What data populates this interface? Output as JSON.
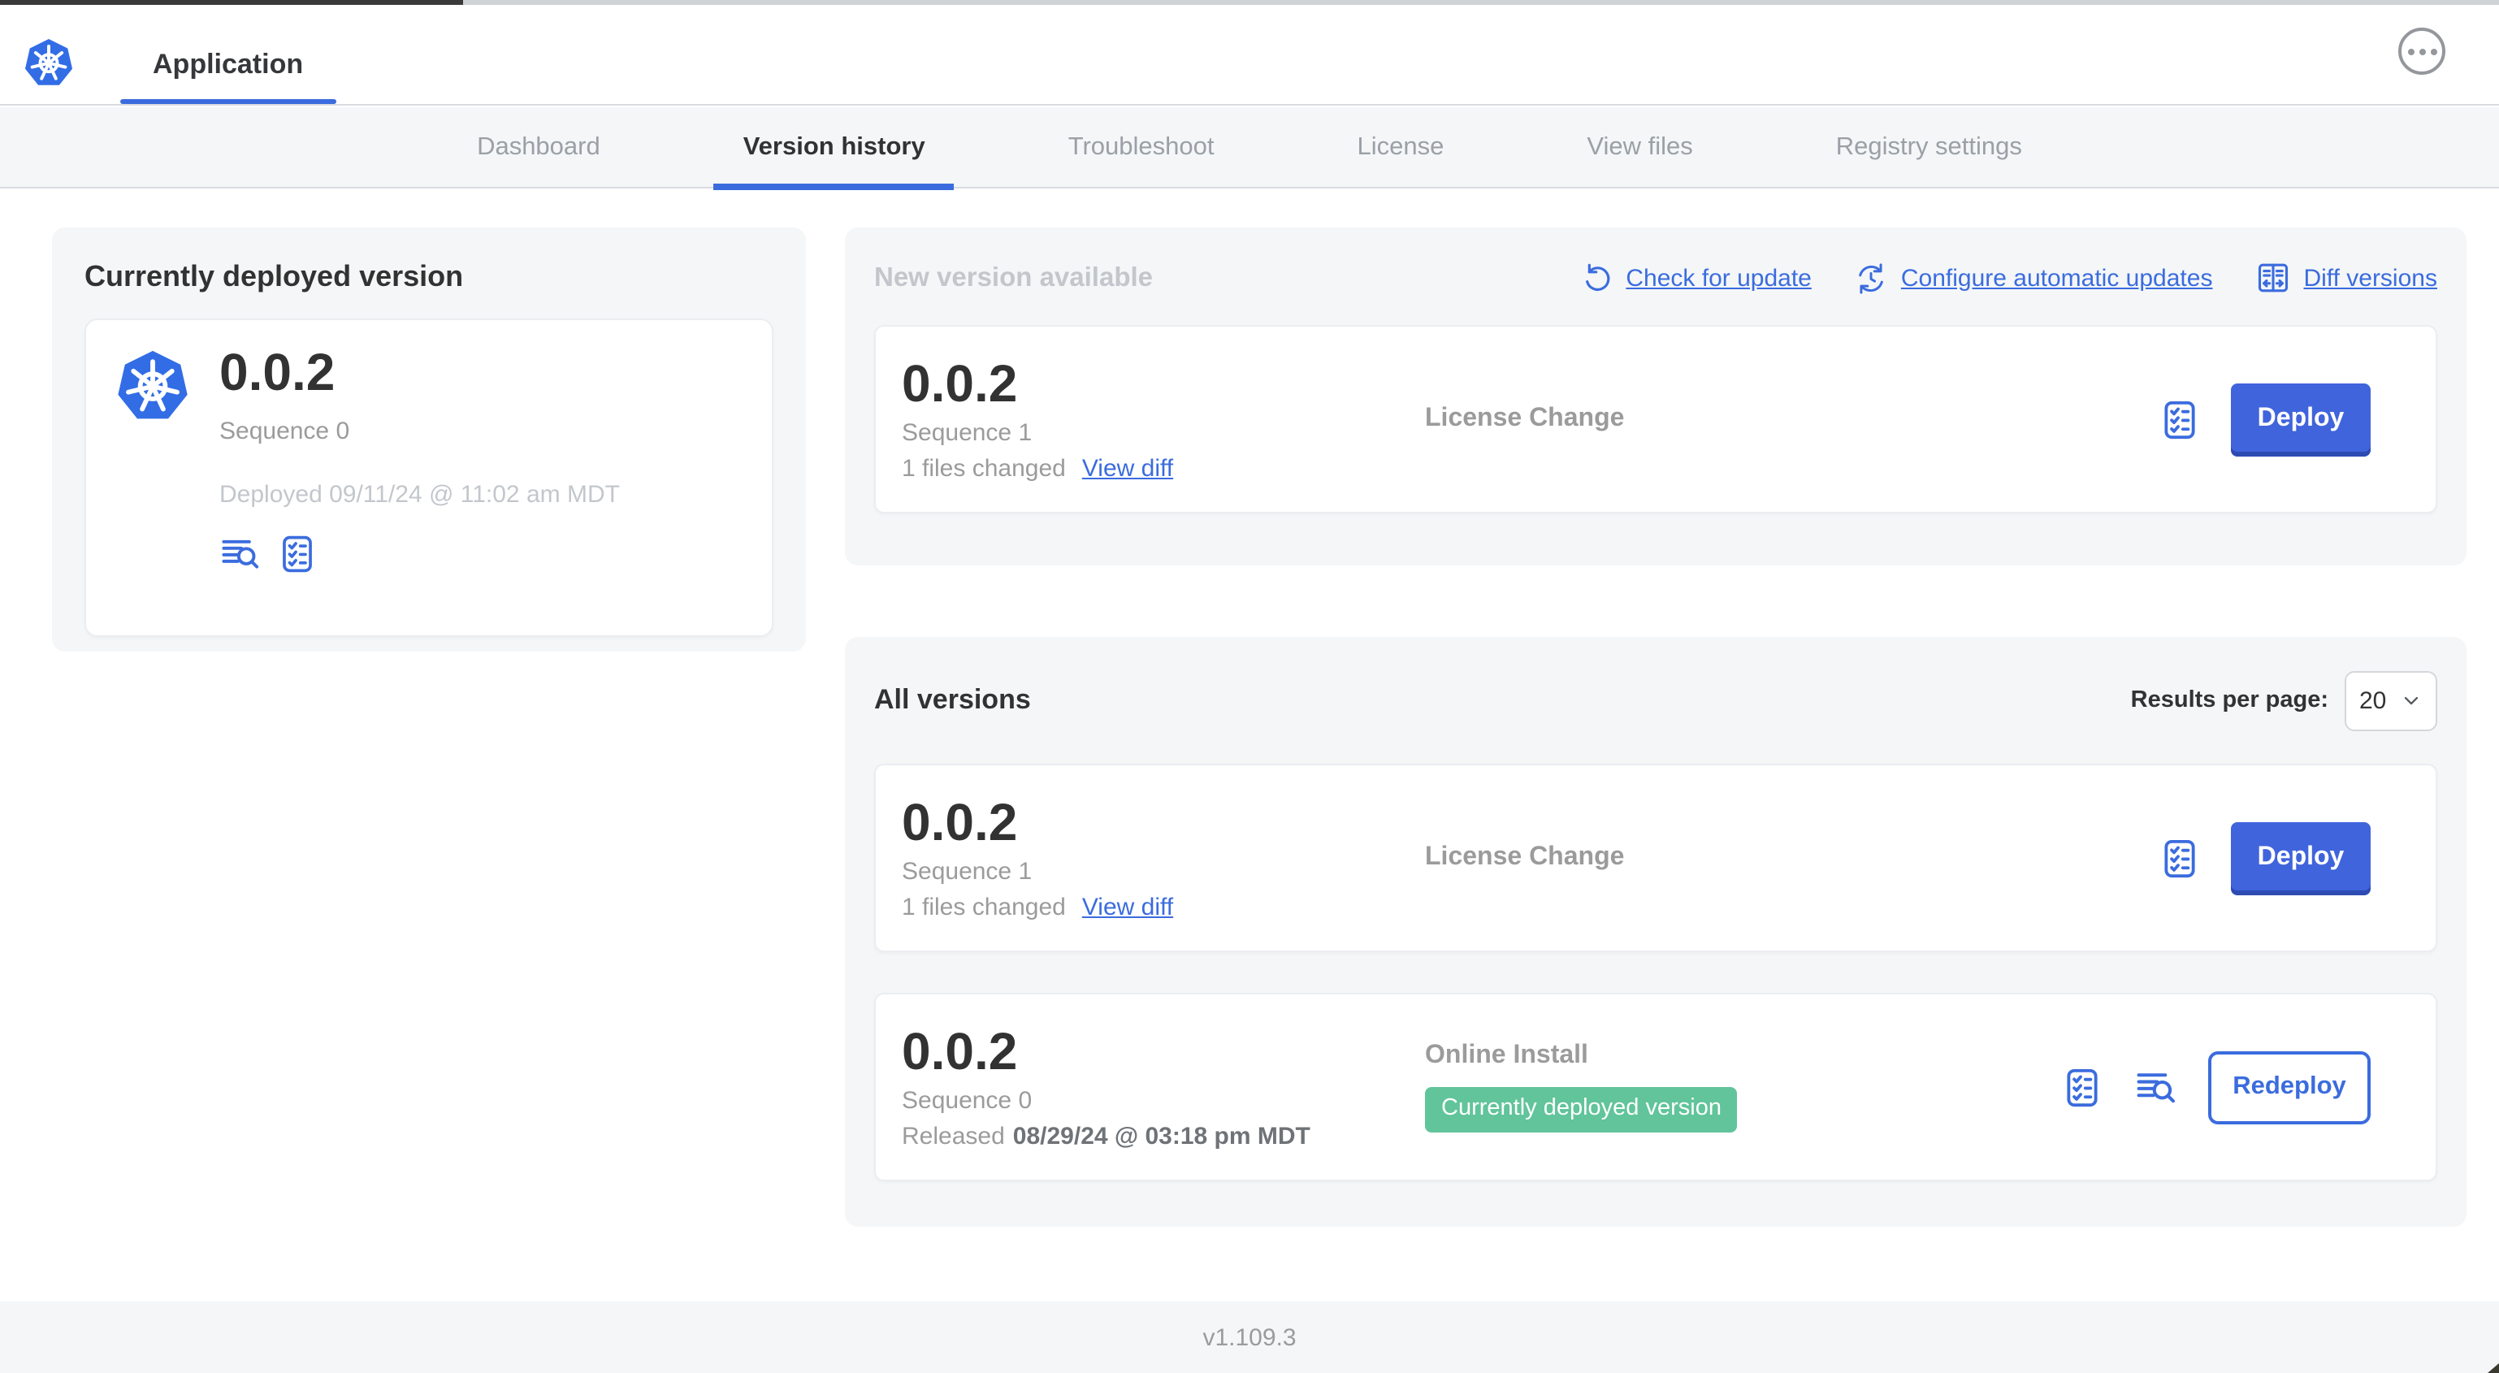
{
  "header": {
    "app_title": "Application",
    "kebab_menu": "more-options"
  },
  "nav": {
    "tabs": [
      {
        "label": "Dashboard",
        "active": false
      },
      {
        "label": "Version history",
        "active": true
      },
      {
        "label": "Troubleshoot",
        "active": false
      },
      {
        "label": "License",
        "active": false
      },
      {
        "label": "View files",
        "active": false
      },
      {
        "label": "Registry settings",
        "active": false
      }
    ]
  },
  "currently_deployed": {
    "title": "Currently deployed version",
    "version": "0.0.2",
    "sequence": "Sequence 0",
    "deployed": "Deployed 09/11/24 @ 11:02 am MDT"
  },
  "new_version": {
    "title": "New version available",
    "check_for_update": "Check for update",
    "configure_automatic_updates": "Configure automatic updates",
    "diff_versions": "Diff versions",
    "row": {
      "version": "0.0.2",
      "sequence": "Sequence 1",
      "files_changed": "1 files changed",
      "view_diff": "View diff",
      "source": "License Change",
      "deploy_label": "Deploy"
    }
  },
  "all_versions": {
    "title": "All versions",
    "results_per_page_label": "Results per page:",
    "results_per_page_value": "20",
    "rows": [
      {
        "version": "0.0.2",
        "sequence": "Sequence 1",
        "files_changed": "1 files changed",
        "view_diff": "View diff",
        "source": "License Change",
        "action_label": "Deploy"
      },
      {
        "version": "0.0.2",
        "sequence": "Sequence 0",
        "released_label": "Released",
        "released_date": "08/29/24 @ 03:18 pm MDT",
        "source": "Online Install",
        "badge": "Currently deployed version",
        "action_label": "Redeploy"
      }
    ]
  },
  "footer": {
    "version": "v1.109.3"
  },
  "icons": {
    "kubernetes-logo-icon": "blue heptagon with white ship wheel",
    "ellipsis-icon": "three dots in circle",
    "refresh-icon": "circular arrow",
    "auto-update-icon": "circular arrows with clock",
    "diff-icon": "split panels with arrows",
    "preflight-checklist-icon": "rounded square with checkmark list",
    "view-logs-icon": "text lines with magnifier",
    "chevron-down-icon": "caret down"
  },
  "colors": {
    "primary_button": "#4064dc",
    "link_blue": "#3b6cde",
    "kubernetes_blue": "#326de6",
    "badge_green": "#61c49a",
    "panel_background": "#f4f6f8"
  }
}
